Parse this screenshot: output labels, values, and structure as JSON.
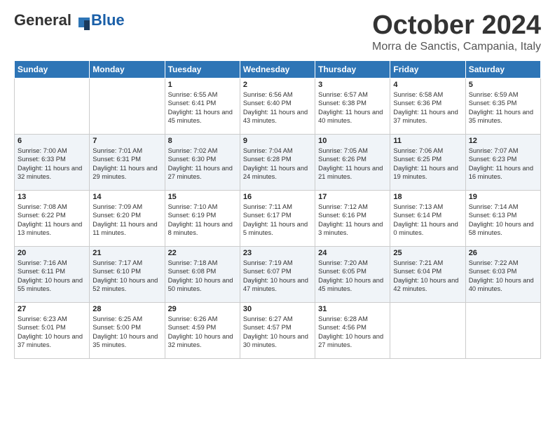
{
  "logo": {
    "general": "General",
    "blue": "Blue"
  },
  "title": "October 2024",
  "location": "Morra de Sanctis, Campania, Italy",
  "days_of_week": [
    "Sunday",
    "Monday",
    "Tuesday",
    "Wednesday",
    "Thursday",
    "Friday",
    "Saturday"
  ],
  "weeks": [
    [
      {
        "day": "",
        "info": ""
      },
      {
        "day": "",
        "info": ""
      },
      {
        "day": "1",
        "info": "Sunrise: 6:55 AM\nSunset: 6:41 PM\nDaylight: 11 hours and 45 minutes."
      },
      {
        "day": "2",
        "info": "Sunrise: 6:56 AM\nSunset: 6:40 PM\nDaylight: 11 hours and 43 minutes."
      },
      {
        "day": "3",
        "info": "Sunrise: 6:57 AM\nSunset: 6:38 PM\nDaylight: 11 hours and 40 minutes."
      },
      {
        "day": "4",
        "info": "Sunrise: 6:58 AM\nSunset: 6:36 PM\nDaylight: 11 hours and 37 minutes."
      },
      {
        "day": "5",
        "info": "Sunrise: 6:59 AM\nSunset: 6:35 PM\nDaylight: 11 hours and 35 minutes."
      }
    ],
    [
      {
        "day": "6",
        "info": "Sunrise: 7:00 AM\nSunset: 6:33 PM\nDaylight: 11 hours and 32 minutes."
      },
      {
        "day": "7",
        "info": "Sunrise: 7:01 AM\nSunset: 6:31 PM\nDaylight: 11 hours and 29 minutes."
      },
      {
        "day": "8",
        "info": "Sunrise: 7:02 AM\nSunset: 6:30 PM\nDaylight: 11 hours and 27 minutes."
      },
      {
        "day": "9",
        "info": "Sunrise: 7:04 AM\nSunset: 6:28 PM\nDaylight: 11 hours and 24 minutes."
      },
      {
        "day": "10",
        "info": "Sunrise: 7:05 AM\nSunset: 6:26 PM\nDaylight: 11 hours and 21 minutes."
      },
      {
        "day": "11",
        "info": "Sunrise: 7:06 AM\nSunset: 6:25 PM\nDaylight: 11 hours and 19 minutes."
      },
      {
        "day": "12",
        "info": "Sunrise: 7:07 AM\nSunset: 6:23 PM\nDaylight: 11 hours and 16 minutes."
      }
    ],
    [
      {
        "day": "13",
        "info": "Sunrise: 7:08 AM\nSunset: 6:22 PM\nDaylight: 11 hours and 13 minutes."
      },
      {
        "day": "14",
        "info": "Sunrise: 7:09 AM\nSunset: 6:20 PM\nDaylight: 11 hours and 11 minutes."
      },
      {
        "day": "15",
        "info": "Sunrise: 7:10 AM\nSunset: 6:19 PM\nDaylight: 11 hours and 8 minutes."
      },
      {
        "day": "16",
        "info": "Sunrise: 7:11 AM\nSunset: 6:17 PM\nDaylight: 11 hours and 5 minutes."
      },
      {
        "day": "17",
        "info": "Sunrise: 7:12 AM\nSunset: 6:16 PM\nDaylight: 11 hours and 3 minutes."
      },
      {
        "day": "18",
        "info": "Sunrise: 7:13 AM\nSunset: 6:14 PM\nDaylight: 11 hours and 0 minutes."
      },
      {
        "day": "19",
        "info": "Sunrise: 7:14 AM\nSunset: 6:13 PM\nDaylight: 10 hours and 58 minutes."
      }
    ],
    [
      {
        "day": "20",
        "info": "Sunrise: 7:16 AM\nSunset: 6:11 PM\nDaylight: 10 hours and 55 minutes."
      },
      {
        "day": "21",
        "info": "Sunrise: 7:17 AM\nSunset: 6:10 PM\nDaylight: 10 hours and 52 minutes."
      },
      {
        "day": "22",
        "info": "Sunrise: 7:18 AM\nSunset: 6:08 PM\nDaylight: 10 hours and 50 minutes."
      },
      {
        "day": "23",
        "info": "Sunrise: 7:19 AM\nSunset: 6:07 PM\nDaylight: 10 hours and 47 minutes."
      },
      {
        "day": "24",
        "info": "Sunrise: 7:20 AM\nSunset: 6:05 PM\nDaylight: 10 hours and 45 minutes."
      },
      {
        "day": "25",
        "info": "Sunrise: 7:21 AM\nSunset: 6:04 PM\nDaylight: 10 hours and 42 minutes."
      },
      {
        "day": "26",
        "info": "Sunrise: 7:22 AM\nSunset: 6:03 PM\nDaylight: 10 hours and 40 minutes."
      }
    ],
    [
      {
        "day": "27",
        "info": "Sunrise: 6:23 AM\nSunset: 5:01 PM\nDaylight: 10 hours and 37 minutes."
      },
      {
        "day": "28",
        "info": "Sunrise: 6:25 AM\nSunset: 5:00 PM\nDaylight: 10 hours and 35 minutes."
      },
      {
        "day": "29",
        "info": "Sunrise: 6:26 AM\nSunset: 4:59 PM\nDaylight: 10 hours and 32 minutes."
      },
      {
        "day": "30",
        "info": "Sunrise: 6:27 AM\nSunset: 4:57 PM\nDaylight: 10 hours and 30 minutes."
      },
      {
        "day": "31",
        "info": "Sunrise: 6:28 AM\nSunset: 4:56 PM\nDaylight: 10 hours and 27 minutes."
      },
      {
        "day": "",
        "info": ""
      },
      {
        "day": "",
        "info": ""
      }
    ]
  ]
}
